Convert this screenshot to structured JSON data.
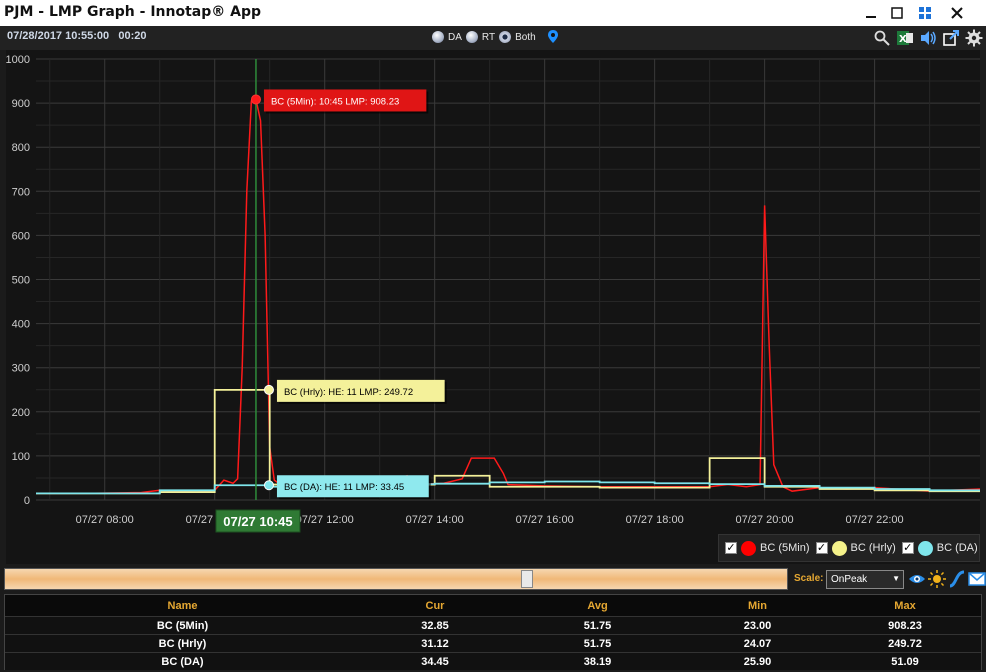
{
  "window": {
    "title": "PJM - LMP Graph - Innotap® App"
  },
  "toolbar": {
    "timestamp": "07/28/2017 10:55:00",
    "interval": "00:20",
    "modes": [
      {
        "label": "DA",
        "selected": false
      },
      {
        "label": "RT",
        "selected": false
      },
      {
        "label": "Both",
        "selected": true
      }
    ],
    "icons": [
      "search-icon",
      "excel-icon",
      "speaker-icon",
      "export-icon",
      "gear-icon"
    ]
  },
  "chart_data": {
    "type": "line",
    "ylim": [
      0,
      1000
    ],
    "yticks": [
      0,
      100,
      200,
      300,
      400,
      500,
      600,
      700,
      800,
      900,
      1000
    ],
    "x_range": [
      "07/27 06:45",
      "07/27 23:55"
    ],
    "xticks": [
      "07/27 08:00",
      "07/27 10:00",
      "07/27 12:00",
      "07/27 14:00",
      "07/27 16:00",
      "07/27 18:00",
      "07/27 20:00",
      "07/27 22:00"
    ],
    "grid": true,
    "legend_position": "bottom-right",
    "series": [
      {
        "name": "BC (5Min)",
        "color": "#ff1a1a",
        "step": false,
        "points": [
          [
            "06:45",
            15
          ],
          [
            "07:40",
            15
          ],
          [
            "08:40",
            17
          ],
          [
            "09:00",
            22
          ],
          [
            "09:20",
            20
          ],
          [
            "09:40",
            18
          ],
          [
            "10:00",
            22
          ],
          [
            "10:10",
            45
          ],
          [
            "10:20",
            38
          ],
          [
            "10:25",
            48
          ],
          [
            "10:30",
            300
          ],
          [
            "10:35",
            700
          ],
          [
            "10:40",
            905
          ],
          [
            "10:45",
            908
          ],
          [
            "10:50",
            860
          ],
          [
            "10:55",
            600
          ],
          [
            "11:00",
            120
          ],
          [
            "11:05",
            45
          ],
          [
            "11:15",
            30
          ],
          [
            "11:40",
            35
          ],
          [
            "12:00",
            38
          ],
          [
            "12:40",
            38
          ],
          [
            "13:10",
            42
          ],
          [
            "13:30",
            55
          ],
          [
            "13:40",
            35
          ],
          [
            "14:10",
            38
          ],
          [
            "14:30",
            48
          ],
          [
            "14:40",
            95
          ],
          [
            "15:05",
            95
          ],
          [
            "15:15",
            60
          ],
          [
            "15:20",
            35
          ],
          [
            "16:00",
            32
          ],
          [
            "17:00",
            30
          ],
          [
            "18:00",
            30
          ],
          [
            "19:00",
            30
          ],
          [
            "19:20",
            35
          ],
          [
            "19:40",
            30
          ],
          [
            "19:55",
            35
          ],
          [
            "20:00",
            668
          ],
          [
            "20:05",
            350
          ],
          [
            "20:10",
            80
          ],
          [
            "20:20",
            30
          ],
          [
            "20:30",
            20
          ],
          [
            "21:00",
            28
          ],
          [
            "21:30",
            25
          ],
          [
            "22:00",
            28
          ],
          [
            "23:00",
            20
          ],
          [
            "23:55",
            25
          ]
        ]
      },
      {
        "name": "BC (Hrly)",
        "color": "#f4f19a",
        "step": true,
        "points": [
          [
            "06:45",
            15
          ],
          [
            "08:00",
            15
          ],
          [
            "09:00",
            18
          ],
          [
            "10:00",
            249.72
          ],
          [
            "11:00",
            35
          ],
          [
            "12:00",
            35
          ],
          [
            "13:00",
            35
          ],
          [
            "14:00",
            55
          ],
          [
            "15:00",
            30
          ],
          [
            "16:00",
            30
          ],
          [
            "17:00",
            28
          ],
          [
            "18:00",
            28
          ],
          [
            "19:00",
            95
          ],
          [
            "20:00",
            30
          ],
          [
            "21:00",
            25
          ],
          [
            "22:00",
            22
          ],
          [
            "23:00",
            20
          ],
          [
            "23:55",
            20
          ]
        ]
      },
      {
        "name": "BC (DA)",
        "color": "#7fe6ec",
        "step": true,
        "points": [
          [
            "06:45",
            15
          ],
          [
            "08:00",
            15
          ],
          [
            "09:00",
            22
          ],
          [
            "10:00",
            33.45
          ],
          [
            "11:00",
            30
          ],
          [
            "12:00",
            35
          ],
          [
            "13:00",
            36
          ],
          [
            "14:00",
            37
          ],
          [
            "15:00",
            40
          ],
          [
            "16:00",
            42
          ],
          [
            "17:00",
            40
          ],
          [
            "18:00",
            38
          ],
          [
            "19:00",
            36
          ],
          [
            "20:00",
            32
          ],
          [
            "21:00",
            28
          ],
          [
            "22:00",
            25
          ],
          [
            "23:00",
            22
          ],
          [
            "23:55",
            22
          ]
        ]
      }
    ],
    "cursor": {
      "time": "10:45",
      "label": "07/27 10:45"
    },
    "tooltips": [
      {
        "text": "BC (5Min): 10:45 LMP: 908.23",
        "series": "BC (5Min)",
        "value": 908.23,
        "bg": "#e01515",
        "fg": "#ffffff"
      },
      {
        "text": "BC (Hrly): HE: 11 LMP: 249.72",
        "series": "BC (Hrly)",
        "value": 249.72,
        "bg": "#f4f19a",
        "fg": "#000000"
      },
      {
        "text": "BC (DA): HE: 11 LMP: 33.45",
        "series": "BC (DA)",
        "value": 33.45,
        "bg": "#8fe9ee",
        "fg": "#000000"
      }
    ]
  },
  "legend": [
    {
      "label": "BC (5Min)",
      "color": "#ff0000",
      "checked": true
    },
    {
      "label": "BC (Hrly)",
      "color": "#f5f28a",
      "checked": true
    },
    {
      "label": "BC (DA)",
      "color": "#7fe6ec",
      "checked": true
    }
  ],
  "scale": {
    "label": "Scale:",
    "value": "OnPeak"
  },
  "stats": {
    "headers": [
      "Name",
      "Cur",
      "Avg",
      "Min",
      "Max"
    ],
    "rows": [
      {
        "name": "BC (5Min)",
        "cur": "32.85",
        "avg": "51.75",
        "min": "23.00",
        "max": "908.23"
      },
      {
        "name": "BC (Hrly)",
        "cur": "31.12",
        "avg": "51.75",
        "min": "24.07",
        "max": "249.72"
      },
      {
        "name": "BC (DA)",
        "cur": "34.45",
        "avg": "38.19",
        "min": "25.90",
        "max": "51.09"
      }
    ]
  }
}
